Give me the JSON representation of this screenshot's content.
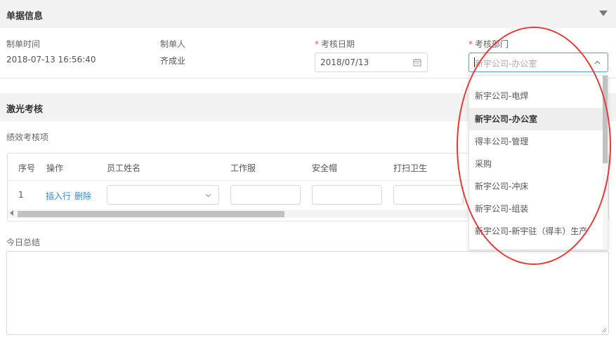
{
  "doc_info": {
    "title": "单据信息",
    "created_time_label": "制单时间",
    "created_time_value": "2018-07-13 16:56:40",
    "creator_label": "制单人",
    "creator_value": "齐成业",
    "review_date_label": "考核日期",
    "review_date_value": "2018/07/13",
    "review_dept_label": "考核部门",
    "review_dept_placeholder": "新宇公司-办公室",
    "required_mark": "*"
  },
  "laser_review": {
    "title": "激光考核",
    "perf_items_label": "绩效考核项",
    "table": {
      "headers": [
        "序号",
        "操作",
        "员工姓名",
        "工作服",
        "安全帽",
        "打扫卫生"
      ],
      "rows": [
        {
          "index": "1",
          "insert_label": "插入行",
          "delete_label": "删除"
        }
      ]
    },
    "summary_label": "今日总结"
  },
  "dept_dropdown": {
    "options": [
      "新宇公司-电焊",
      "新宇公司-办公室",
      "得丰公司-管理",
      "采购",
      "新宇公司-冲床",
      "新宇公司-组装",
      "新宇公司-新宇驻（得丰）生产",
      "新宇公司-切料"
    ],
    "selected_index": 1
  },
  "colors": {
    "link": "#2a8ce0",
    "required": "#e05252",
    "annotation": "#e33a3a",
    "focus_border": "#5b9bd5"
  }
}
